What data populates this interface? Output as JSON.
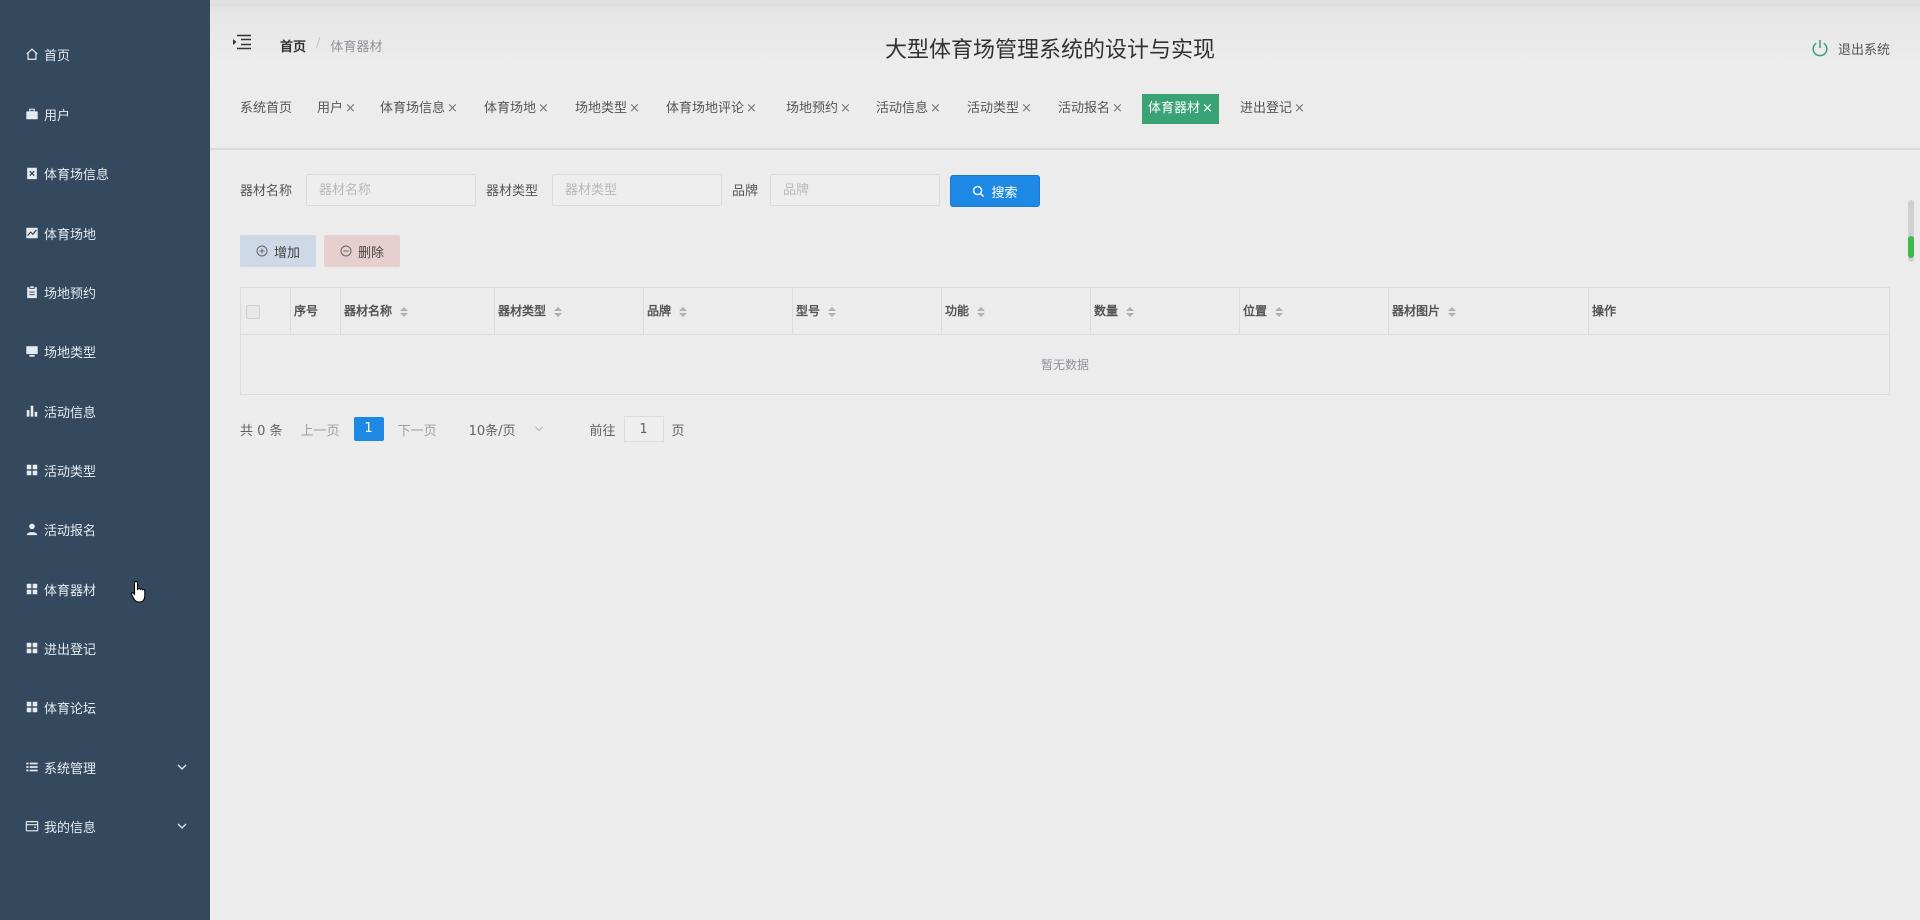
{
  "sidebar": {
    "items": [
      {
        "label": "首页",
        "icon": "home-icon"
      },
      {
        "label": "用户",
        "icon": "briefcase-icon"
      },
      {
        "label": "体育场信息",
        "icon": "clipboard-x-icon"
      },
      {
        "label": "体育场地",
        "icon": "chart-line-icon"
      },
      {
        "label": "场地预约",
        "icon": "clipboard-icon"
      },
      {
        "label": "场地类型",
        "icon": "monitor-icon"
      },
      {
        "label": "活动信息",
        "icon": "bar-chart-icon"
      },
      {
        "label": "活动类型",
        "icon": "grid-icon"
      },
      {
        "label": "活动报名",
        "icon": "user-icon"
      },
      {
        "label": "体育器材",
        "icon": "grid-icon"
      },
      {
        "label": "进出登记",
        "icon": "grid-icon"
      },
      {
        "label": "体育论坛",
        "icon": "grid-icon"
      },
      {
        "label": "系统管理",
        "icon": "list-icon"
      },
      {
        "label": "我的信息",
        "icon": "wallet-icon"
      }
    ]
  },
  "header": {
    "breadcrumb_home": "首页",
    "breadcrumb_separator": "/",
    "breadcrumb_current": "体育器材",
    "title": "大型体育场管理系统的设计与实现",
    "logout": "退出系统"
  },
  "tabs": [
    {
      "label": "系统首页",
      "closable": false
    },
    {
      "label": "用户",
      "closable": true
    },
    {
      "label": "体育场信息",
      "closable": true
    },
    {
      "label": "体育场地",
      "closable": true
    },
    {
      "label": "场地类型",
      "closable": true
    },
    {
      "label": "体育场地评论",
      "closable": true
    },
    {
      "label": "场地预约",
      "closable": true
    },
    {
      "label": "活动信息",
      "closable": true
    },
    {
      "label": "活动类型",
      "closable": true
    },
    {
      "label": "活动报名",
      "closable": true
    },
    {
      "label": "体育器材",
      "closable": true,
      "active": true
    },
    {
      "label": "进出登记",
      "closable": true
    }
  ],
  "tab_close_glyph": "×",
  "filters": {
    "name_label": "器材名称",
    "name_placeholder": "器材名称",
    "type_label": "器材类型",
    "type_placeholder": "器材类型",
    "brand_label": "品牌",
    "brand_placeholder": "品牌",
    "search_button": "搜索"
  },
  "actions": {
    "add": "增加",
    "delete": "删除"
  },
  "table": {
    "columns": [
      "序号",
      "器材名称",
      "器材类型",
      "品牌",
      "型号",
      "功能",
      "数量",
      "位置",
      "器材图片",
      "操作"
    ],
    "empty_text": "暂无数据"
  },
  "pagination": {
    "total": "共 0 条",
    "prev": "上一页",
    "current_page": "1",
    "next": "下一页",
    "page_size": "10条/页",
    "goto_label": "前往",
    "goto_value": "1",
    "goto_suffix": "页"
  },
  "colors": {
    "sidebar_bg": "#34495e",
    "active_tab": "#3aa376",
    "primary": "#1e88e5",
    "logout_icon": "#3aa376"
  }
}
